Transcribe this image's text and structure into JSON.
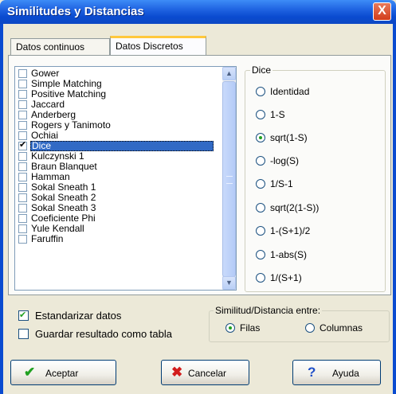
{
  "window": {
    "title": "Similitudes y Distancias",
    "close_glyph": "X"
  },
  "tabs": [
    {
      "label": "Datos continuos",
      "active": false
    },
    {
      "label": "Datos Discretos",
      "active": true
    }
  ],
  "list": {
    "items": [
      {
        "label": "Gower",
        "checked": false
      },
      {
        "label": "Simple Matching",
        "checked": false
      },
      {
        "label": "Positive Matching",
        "checked": false
      },
      {
        "label": "Jaccard",
        "checked": false
      },
      {
        "label": "Anderberg",
        "checked": false
      },
      {
        "label": "Rogers y Tanimoto",
        "checked": false
      },
      {
        "label": "Ochiai",
        "checked": false
      },
      {
        "label": "Dice",
        "checked": true,
        "selected": true
      },
      {
        "label": "Kulczynski 1",
        "checked": false
      },
      {
        "label": "Braun Blanquet",
        "checked": false
      },
      {
        "label": "Hamman",
        "checked": false
      },
      {
        "label": "Sokal Sneath 1",
        "checked": false
      },
      {
        "label": "Sokal Sneath 2",
        "checked": false
      },
      {
        "label": "Sokal Sneath 3",
        "checked": false
      },
      {
        "label": "Coeficiente Phi",
        "checked": false
      },
      {
        "label": "Yule Kendall",
        "checked": false
      },
      {
        "label": "Faruffin",
        "checked": false
      }
    ]
  },
  "dice_group": {
    "title": "Dice",
    "options": [
      {
        "label": "Identidad",
        "selected": false
      },
      {
        "label": "1-S",
        "selected": false
      },
      {
        "label": "sqrt(1-S)",
        "selected": true
      },
      {
        "label": "-log(S)",
        "selected": false
      },
      {
        "label": "1/S-1",
        "selected": false
      },
      {
        "label": "sqrt(2(1-S))",
        "selected": false
      },
      {
        "label": "1-(S+1)/2",
        "selected": false
      },
      {
        "label": "1-abs(S)",
        "selected": false
      },
      {
        "label": "1/(S+1)",
        "selected": false
      }
    ]
  },
  "options": {
    "standardize_label": "Estandarizar datos",
    "standardize_checked": true,
    "save_table_label": "Guardar resultado como tabla",
    "save_table_checked": false
  },
  "between_group": {
    "title": "Similitud/Distancia entre:",
    "rows_label": "Filas",
    "cols_label": "Columnas",
    "selected": "Filas"
  },
  "buttons": {
    "accept_label": "Aceptar",
    "cancel_label": "Cancelar",
    "help_label": "Ayuda"
  },
  "colors": {
    "title_bar": "#0a4bd0",
    "selection": "#316ac5",
    "accept_icon": "#21a121",
    "cancel_icon": "#d21c1c",
    "help_icon": "#1f4fc8"
  }
}
